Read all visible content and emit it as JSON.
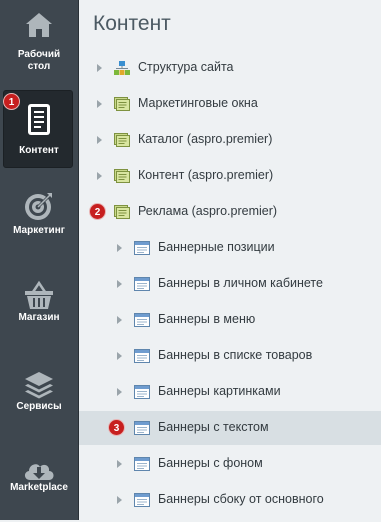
{
  "sidebar": {
    "items": [
      {
        "label_lines": [
          "Рабочий",
          "стол"
        ],
        "icon": "home-icon"
      },
      {
        "label_lines": [
          "Контент"
        ],
        "icon": "document-icon",
        "active": true,
        "badge": "1"
      },
      {
        "label_lines": [
          "Маркетинг"
        ],
        "icon": "target-icon"
      },
      {
        "label_lines": [
          "Магазин"
        ],
        "icon": "basket-icon"
      },
      {
        "label_lines": [
          "Сервисы"
        ],
        "icon": "layers-icon"
      },
      {
        "label_lines": [
          "Marketplace"
        ],
        "icon": "cloud-download-icon"
      }
    ]
  },
  "panel": {
    "title": "Контент",
    "tree": [
      {
        "label": "Структура сайта",
        "icon": "sitemap-icon",
        "level": 0
      },
      {
        "label": "Маркетинговые окна",
        "icon": "iblock-type-icon",
        "level": 0
      },
      {
        "label": "Каталог (aspro.premier)",
        "icon": "iblock-type-icon",
        "level": 0
      },
      {
        "label": "Контент (aspro.premier)",
        "icon": "iblock-type-icon",
        "level": 0
      },
      {
        "label": "Реклама (aspro.premier)",
        "icon": "iblock-type-icon",
        "level": 0,
        "badge": "2"
      },
      {
        "label": "Баннерные позиции",
        "icon": "iblock-icon",
        "level": 1
      },
      {
        "label": "Баннеры в личном кабинете",
        "icon": "iblock-icon",
        "level": 1
      },
      {
        "label": "Баннеры в меню",
        "icon": "iblock-icon",
        "level": 1
      },
      {
        "label": "Баннеры в списке товаров",
        "icon": "iblock-icon",
        "level": 1
      },
      {
        "label": "Баннеры картинками",
        "icon": "iblock-icon",
        "level": 1
      },
      {
        "label": "Баннеры с текстом",
        "icon": "iblock-icon",
        "level": 1,
        "badge": "3",
        "selected": true
      },
      {
        "label": "Баннеры с фоном",
        "icon": "iblock-icon",
        "level": 1
      },
      {
        "label": "Баннеры сбоку от основного",
        "icon": "iblock-icon",
        "level": 1
      }
    ]
  }
}
